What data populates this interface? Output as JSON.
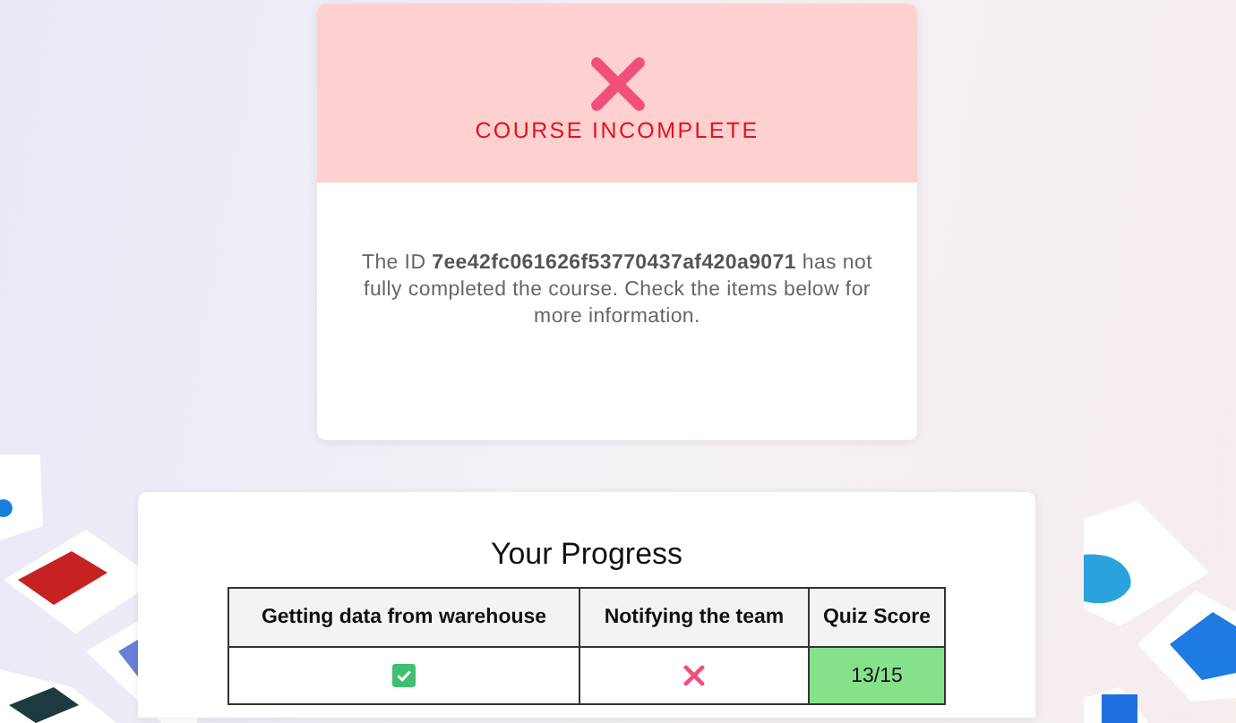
{
  "result": {
    "complete": false,
    "title": "COURSE INCOMPLETE"
  },
  "message": "The ID **7ee42fc061626f53770437af420a9071** has not fully completed the course. Check the items below for more information.",
  "progress": {
    "title": "Your Progress",
    "columns": [
      "Getting data from warehouse",
      "Notifying the team",
      "Quiz Score"
    ],
    "cells": [
      {
        "kind": "status",
        "done": true
      },
      {
        "kind": "status",
        "done": false
      },
      {
        "kind": "score",
        "text": "13/15",
        "passed": true
      }
    ]
  }
}
